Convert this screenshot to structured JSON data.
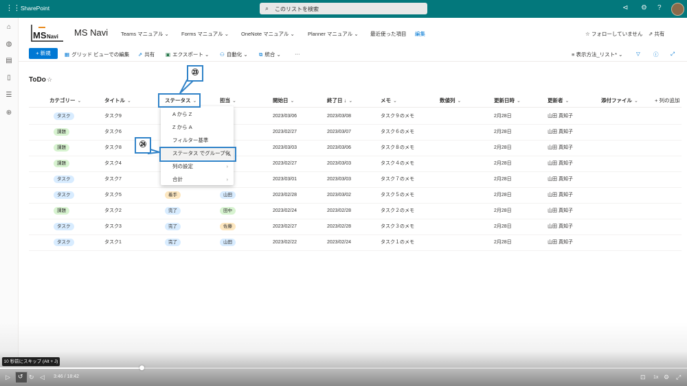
{
  "suitebar": {
    "app_name": "SharePoint",
    "search_placeholder": "このリストを検索",
    "icons": [
      "waffle-icon",
      "search-icon",
      "megaphone-icon",
      "settings-icon",
      "help-icon"
    ]
  },
  "site": {
    "logo_text_left": "MS",
    "logo_text_right": "Navi",
    "title": "MS Navi",
    "nav": [
      {
        "label": "Teams マニュアル",
        "has_dropdown": true
      },
      {
        "label": "Forms マニュアル",
        "has_dropdown": true
      },
      {
        "label": "OneNote マニュアル",
        "has_dropdown": true
      },
      {
        "label": "Planner マニュアル",
        "has_dropdown": true
      },
      {
        "label": "最近使った項目",
        "has_dropdown": false
      }
    ],
    "edit_label": "編集",
    "follow_label": "フォローしていません",
    "share_label": "共有"
  },
  "commandbar": {
    "new_label": "新規",
    "grid_edit_label": "グリッド ビューでの編集",
    "share_label": "共有",
    "export_label": "エクスポート",
    "automate_label": "自動化",
    "integrate_label": "統合",
    "more_label": "···",
    "view_options_label": "表示方法_リスト*"
  },
  "list": {
    "title": "ToDo",
    "columns": [
      "カテゴリー",
      "タイトル",
      "ステータス",
      "担当",
      "開始日",
      "終了日 ↓",
      "メモ",
      "数値列",
      "更新日時",
      "更新者",
      "添付ファイル",
      "列の追加"
    ],
    "rows": [
      {
        "category": "タスク",
        "title": "タスク9",
        "status": "",
        "owner": "",
        "start": "2023/03/06",
        "end": "2023/03/08",
        "memo": "タスク９のメモ",
        "modified": "2月28日",
        "editor": "山田 真知子"
      },
      {
        "category": "課題",
        "title": "タスク6",
        "status": "",
        "owner": "",
        "start": "2023/02/27",
        "end": "2023/03/07",
        "memo": "タスク６のメモ",
        "modified": "2月28日",
        "editor": "山田 真知子"
      },
      {
        "category": "課題",
        "title": "タスク8",
        "status": "",
        "owner": "",
        "start": "2023/03/03",
        "end": "2023/03/06",
        "memo": "タスク８のメモ",
        "modified": "2月28日",
        "editor": "山田 真知子"
      },
      {
        "category": "課題",
        "title": "タスク4",
        "status": "",
        "owner": "",
        "start": "2023/02/27",
        "end": "2023/03/03",
        "memo": "タスク４のメモ",
        "modified": "2月28日",
        "editor": "山田 真知子"
      },
      {
        "category": "タスク",
        "title": "タスク7",
        "status": "",
        "owner": "",
        "start": "2023/03/01",
        "end": "2023/03/03",
        "memo": "タスク７のメモ",
        "modified": "2月28日",
        "editor": "山田 真知子"
      },
      {
        "category": "タスク",
        "title": "タスク5",
        "status": "着手",
        "owner": "山田",
        "start": "2023/02/28",
        "end": "2023/03/02",
        "memo": "タスク５のメモ",
        "modified": "2月28日",
        "editor": "山田 真知子"
      },
      {
        "category": "課題",
        "title": "タスク2",
        "status": "完了",
        "owner": "田中",
        "start": "2023/02/24",
        "end": "2023/02/28",
        "memo": "タスク２のメモ",
        "modified": "2月28日",
        "editor": "山田 真知子"
      },
      {
        "category": "タスク",
        "title": "タスク3",
        "status": "完了",
        "owner": "佐藤",
        "start": "2023/02/27",
        "end": "2023/02/28",
        "memo": "タスク３のメモ",
        "modified": "2月28日",
        "editor": "山田 真知子"
      },
      {
        "category": "タスク",
        "title": "タスク1",
        "status": "完了",
        "owner": "山田",
        "start": "2023/02/22",
        "end": "2023/02/24",
        "memo": "タスク１のメモ",
        "modified": "2月28日",
        "editor": "山田 真知子"
      }
    ]
  },
  "column_menu": {
    "items": [
      {
        "label": "A から Z",
        "submenu": false
      },
      {
        "label": "Z から A",
        "submenu": false
      },
      {
        "label": "フィルター基準",
        "submenu": false
      },
      {
        "label": "ステータス でグループ化",
        "submenu": false
      },
      {
        "label": "列の設定",
        "submenu": true
      },
      {
        "label": "合計",
        "submenu": true
      }
    ]
  },
  "callouts": {
    "step23": "㉓",
    "step24": "㉔"
  },
  "video": {
    "tooltip": "10 秒前にスキップ (Alt + J)",
    "time": "3:46 / 18:42",
    "progress": 0.206,
    "speed": "1x"
  },
  "colors": {
    "suitebar": "#03787c",
    "accent": "#0078d4",
    "callout_border": "#2f82c8",
    "pill_task": "#d8ecff",
    "pill_issue": "#d7f3d0",
    "pill_in_progress": "#fde7c0",
    "pill_done": "#d8ecff",
    "pill_owner_yamada": "#d8ecff",
    "pill_owner_tanaka": "#d7f3d0",
    "pill_owner_sato": "#fde7c0"
  }
}
